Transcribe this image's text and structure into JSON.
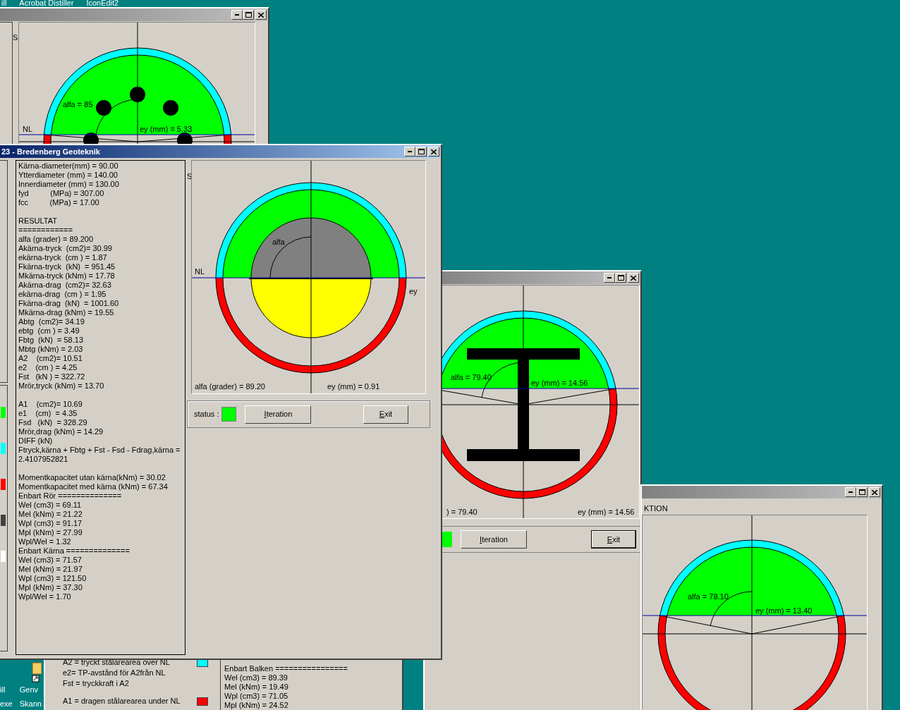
{
  "taskbar": {
    "items": [
      {
        "label": "ill"
      },
      {
        "label": "Acrobat Distiller"
      },
      {
        "label": "IconEdit2"
      }
    ]
  },
  "desktop_icons": [
    {
      "kind": "label_only",
      "lines": [
        "ill",
        "exe"
      ]
    },
    {
      "kind": "shortcut",
      "lines": [
        "Genv",
        "Skann"
      ]
    }
  ],
  "window_top_left": {
    "active": false,
    "side_label": "S",
    "section": {
      "kind": "bars",
      "nl_label": "NL",
      "alfa_label": "alfa = 85",
      "ey_label": "ey (mm) = 5.33"
    }
  },
  "window_legend": {
    "legend_groups": [
      [
        {
          "text": "A2 = tryckt stålarearea över NL",
          "color": "#00ffff"
        },
        {
          "text": "e2= TP-avstånd för A2från NL"
        },
        {
          "text": "Fst = tryckkraft i A2"
        }
      ],
      [
        {
          "text": "A1 = dragen stålarearea under NL",
          "color": "#ff0000"
        }
      ]
    ],
    "results": [
      "Enbart Balken ================",
      "Wel (cm3) = 89.39",
      "Mel (kNm) = 19.49",
      "Wpl (cm3) = 71.05",
      "Mpl (kNm) = 24.52"
    ]
  },
  "window_ibeam": {
    "active": false,
    "section": {
      "kind": "ibeam",
      "alfa_label": "alfa = 79.40",
      "ey_label": "ey (mm) = 14.56",
      "bottom_left": ") = 79.40",
      "bottom_right": "ey (mm) = 14.56"
    },
    "status": {
      "color": "#00ff00"
    },
    "buttons": [
      {
        "label": "Iteration",
        "accelerator": true,
        "default": false
      },
      {
        "label": "Exit",
        "accelerator": true,
        "default": true
      }
    ]
  },
  "window_right": {
    "active": false,
    "heading": "KTION",
    "section": {
      "kind": "plain",
      "alfa_label": "alfa = 78.10",
      "ey_label": "ey (mm) = 13.40"
    }
  },
  "main_window": {
    "active": true,
    "title": "23 - Bredenberg Geoteknik",
    "legend_swatches": [
      {
        "color": "#00ff00"
      },
      {
        "color": "#00ffff"
      },
      {
        "color": "#ff0000"
      },
      {
        "color": "#404040"
      },
      {
        "color": "#ffffff"
      }
    ],
    "report_blocks": [
      [
        "Kärna-diameter(mm) = 90.00",
        "Ytterdiameter (mm) = 140.00",
        "Innerdiameter (mm) = 130.00",
        "fyd          (MPa) = 307.00",
        "fcc          (MPa) = 17.00"
      ],
      [
        "RESULTAT",
        "============",
        "alfa (grader) = 89.200",
        "Akärna-tryck  (cm2)= 30.99",
        "ekärna-tryck  (cm ) = 1.87",
        "Fkärna-tryck  (kN)  = 951.45",
        "Mkärna-tryck (kNm) = 17.78",
        "Akärna-drag  (cm2)= 32.63",
        "ekärna-drag  (cm ) = 1.95",
        "Fkärna-drag  (kN)  = 1001.60",
        "Mkärna-drag (kNm) = 19.55",
        "Abtg  (cm2)= 34.19",
        "ebtg  (cm ) = 3.49",
        "Fbtg  (kN)  = 58.13",
        "Mbtg (kNm) = 2.03",
        "A2    (cm2)= 10.51",
        "e2    (cm ) = 4.25",
        "Fst   (kN ) = 322.72",
        "Mrör,tryck (kNm) = 13.70"
      ],
      [
        "A1    (cm2)= 10.69",
        "e1    (cm)  = 4.35",
        "Fsd   (kN)  = 328.29",
        "Mrör,drag (kNm) = 14.29",
        "DIFF (kN)",
        "Ftryck,kärna + Fbtg + Fst - Fsd - Fdrag,kärna =",
        "2.4107952821"
      ],
      [
        "Momentkapacitet utan kärna(kNm) = 30.02",
        "Momentkapacitet med kärna (kNm) = 67.34",
        "Enbart Rör ==============",
        "Wel (cm3) = 69.11",
        "Mel (kNm) = 21.22",
        "Wpl (cm3) = 91.17",
        "Mpl (kNm) = 27.99",
        "Wpl/Wel = 1.32",
        "Enbart Kärna ==============",
        "Wel (cm3) = 71.57",
        "Mel (kNm) = 21.97",
        "Wpl (cm3) = 121.50",
        "Mpl (kNm) = 37.30",
        "Wpl/Wel = 1.70"
      ]
    ],
    "side_label": "S",
    "section": {
      "kind": "core",
      "nl_label": "NL",
      "alfa_label": "alfa",
      "ey_label": "ey",
      "bottom_left": "alfa (grader) = 89.20",
      "bottom_right": "ey (mm) = 0.91"
    },
    "status": {
      "label": "status :",
      "color": "#00ff00"
    },
    "buttons": [
      {
        "label": "Iteration",
        "accelerator": true,
        "default": false
      },
      {
        "label": "Exit",
        "accelerator": true,
        "default": false
      }
    ]
  }
}
